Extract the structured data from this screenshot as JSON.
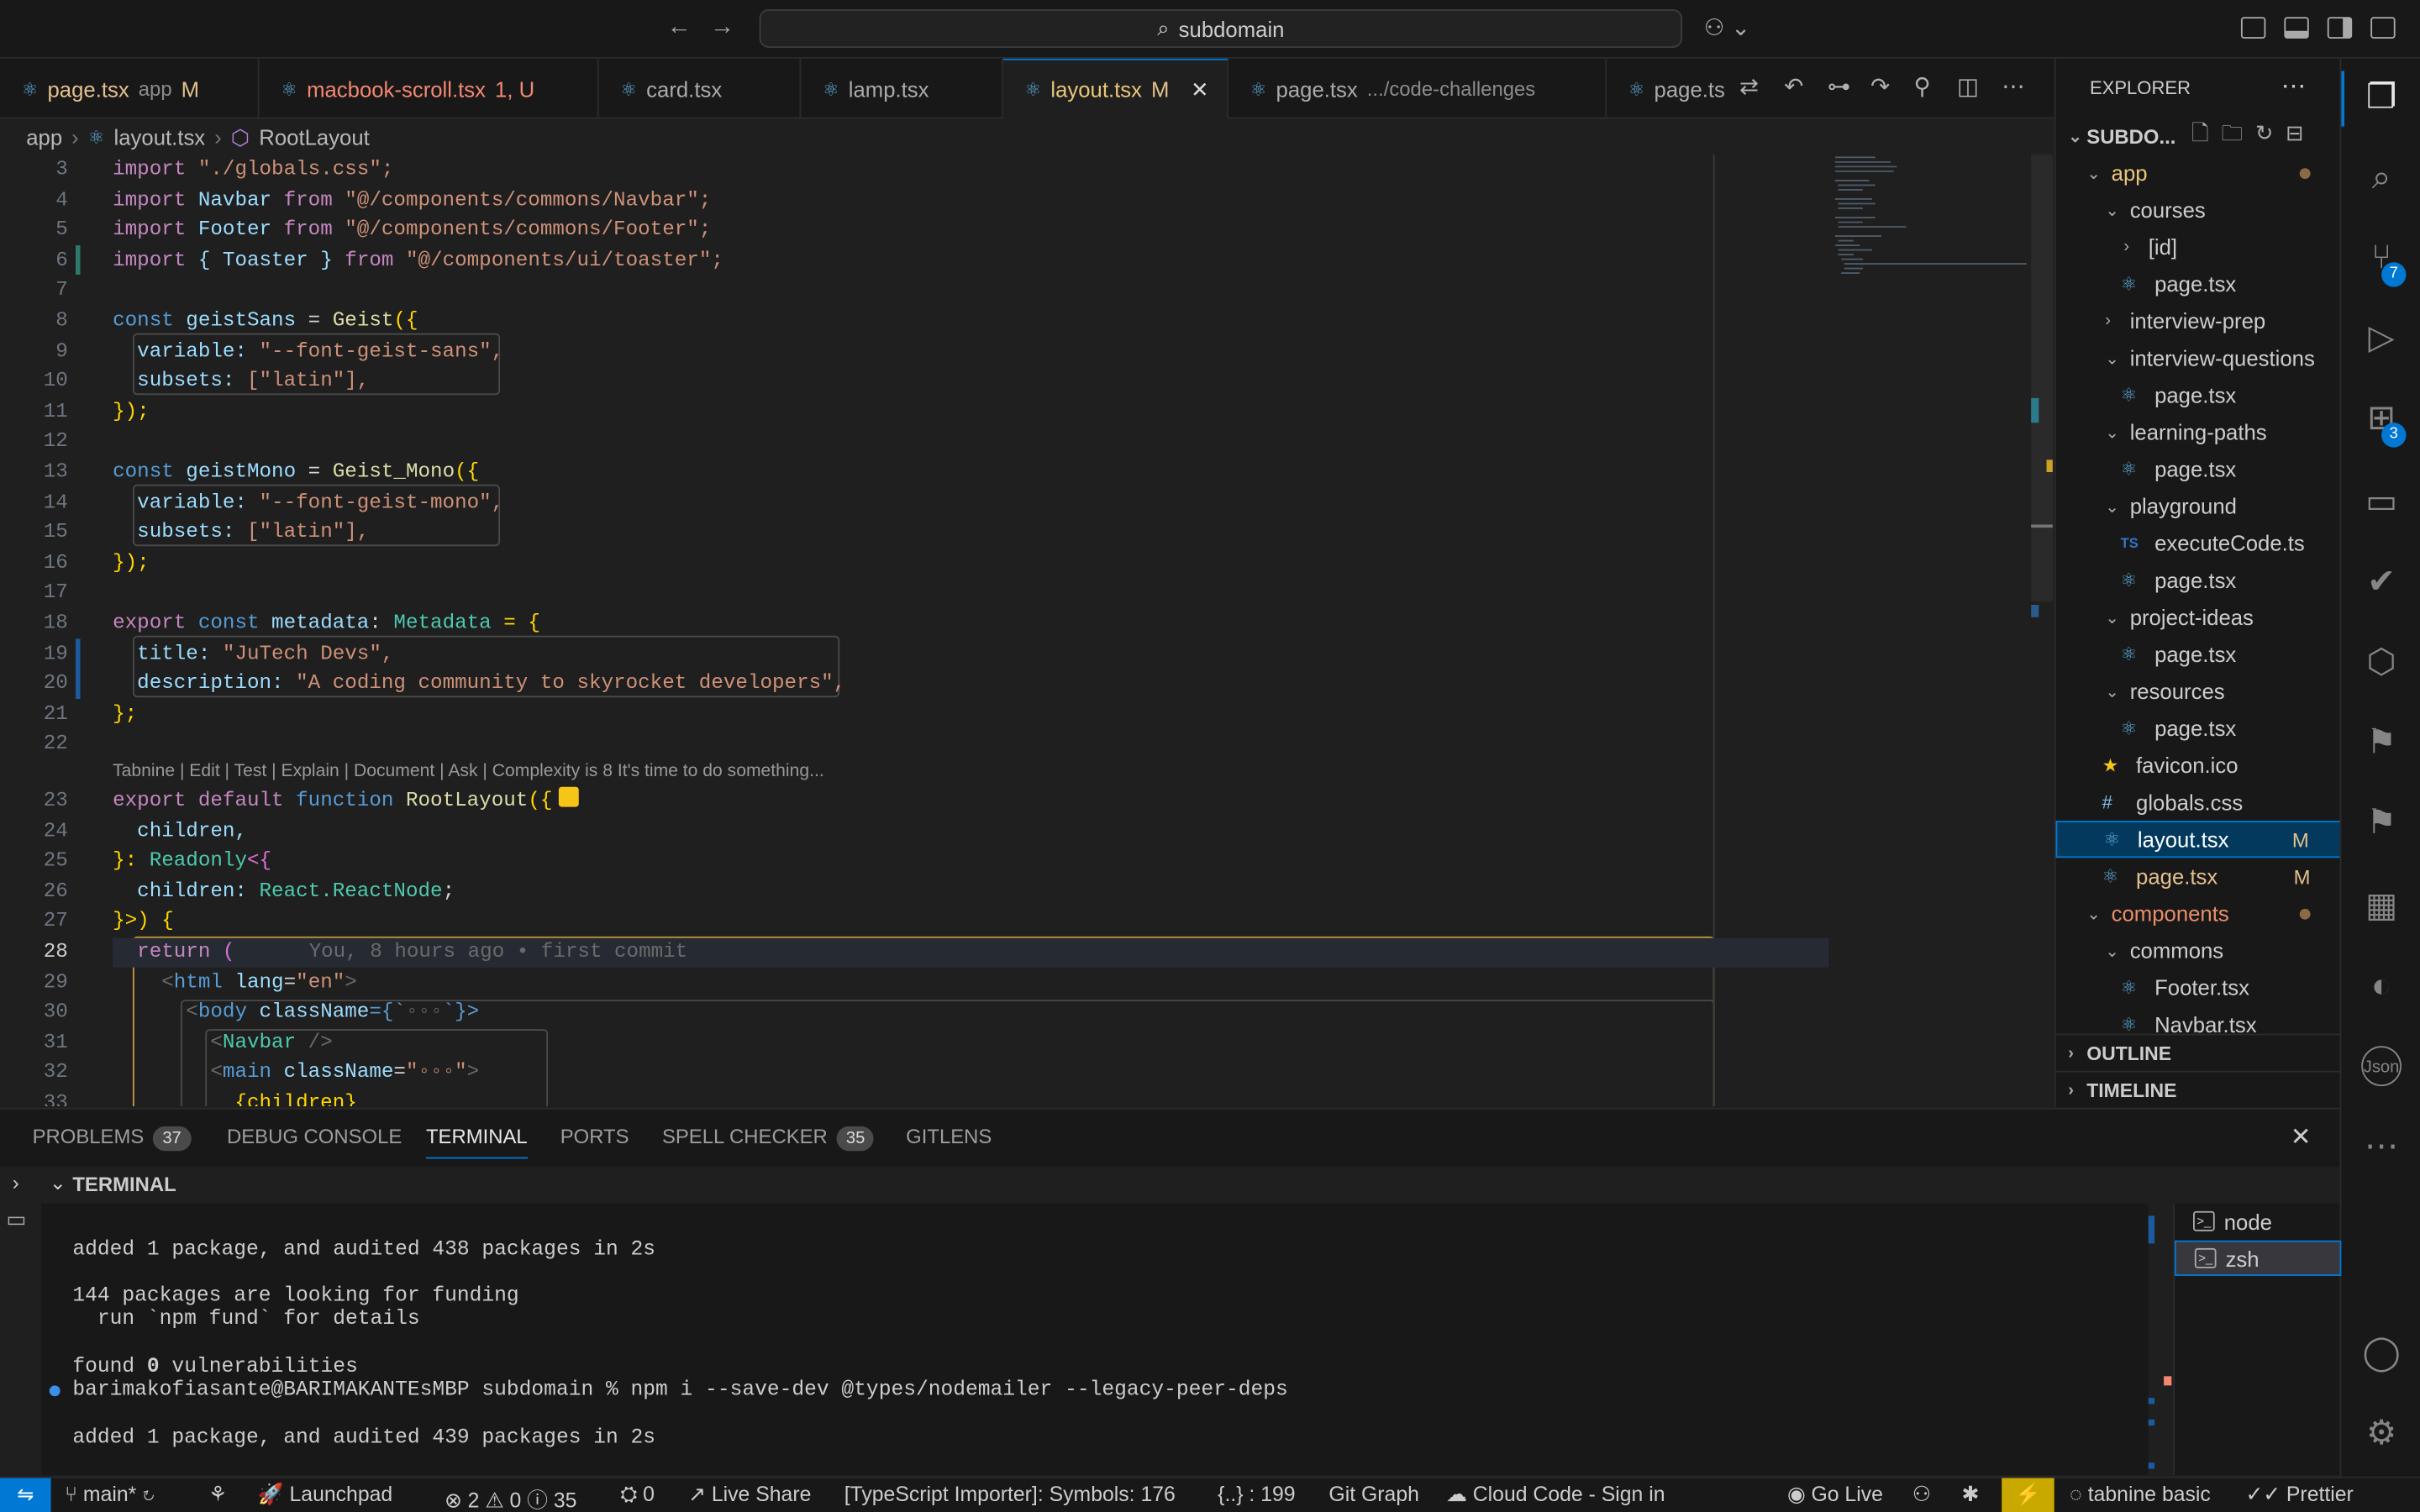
{
  "title_bar": {
    "search": "subdomain",
    "back_icon": "arrow-left-icon",
    "forward_icon": "arrow-right-icon"
  },
  "tabs": [
    {
      "label": "page.tsx",
      "suffix": "app",
      "status": "M"
    },
    {
      "label": "macbook-scroll.tsx",
      "suffix": "",
      "status": "1, U"
    },
    {
      "label": "card.tsx",
      "suffix": "",
      "status": ""
    },
    {
      "label": "lamp.tsx",
      "suffix": "",
      "status": ""
    },
    {
      "label": "layout.tsx",
      "suffix": "",
      "status": "M"
    },
    {
      "label": "page.tsx",
      "suffix": ".../code-challenges",
      "status": ""
    },
    {
      "label": "page.ts",
      "suffix": "",
      "status": ""
    }
  ],
  "breadcrumb": {
    "folder": "app",
    "file": "layout.tsx",
    "symbol": "RootLayout"
  },
  "editor": {
    "codelens": "Tabnine | Edit | Test | Explain | Document | Ask | Complexity is 8 It's time to do something...",
    "blame": "You, 8 hours ago • first commit",
    "line_numbers": [
      "3",
      "4",
      "5",
      "6",
      "7",
      "8",
      "9",
      "10",
      "11",
      "12",
      "13",
      "14",
      "15",
      "16",
      "17",
      "18",
      "19",
      "20",
      "21",
      "22",
      "23",
      "24",
      "25",
      "26",
      "27",
      "28",
      "29",
      "30",
      "31",
      "32",
      "33"
    ],
    "lines": {
      "l3": [
        "import",
        " \"./globals.css\";"
      ],
      "l4": [
        "import",
        " Navbar ",
        "from",
        " \"@/components/commons/Navbar\";"
      ],
      "l5": [
        "import",
        " Footer ",
        "from",
        " \"@/components/commons/Footer\";"
      ],
      "l6": [
        "import",
        " { Toaster } ",
        "from",
        " \"@/components/ui/toaster\";"
      ],
      "l8": [
        "const",
        " geistSans",
        " = ",
        "Geist",
        "({"
      ],
      "l9": [
        "  variable: ",
        "\"--font-geist-sans\","
      ],
      "l10": [
        "  subsets: ",
        "[\"latin\"],"
      ],
      "l11": [
        "});"
      ],
      "l13": [
        "const",
        " geistMono",
        " = ",
        "Geist_Mono",
        "({"
      ],
      "l14": [
        "  variable: ",
        "\"--font-geist-mono\","
      ],
      "l15": [
        "  subsets: ",
        "[\"latin\"],"
      ],
      "l16": [
        "});"
      ],
      "l18": [
        "export",
        " const",
        " metadata",
        ": ",
        "Metadata",
        " = {"
      ],
      "l19": [
        "  title: ",
        "\"JuTech Devs\","
      ],
      "l20": [
        "  description: ",
        "\"A coding community to skyrocket developers\","
      ],
      "l21": [
        "};"
      ],
      "l23": [
        "export",
        " default",
        " function",
        " RootLayout",
        "({"
      ],
      "l24": [
        "  children,"
      ],
      "l25": [
        "}: ",
        "Readonly",
        "<{"
      ],
      "l26": [
        "  children: ",
        "React.ReactNode",
        ";"
      ],
      "l27": [
        "}>) {"
      ],
      "l28": [
        "  return",
        " ("
      ],
      "l29": [
        "    <",
        "html",
        " lang",
        "=",
        "\"en\"",
        ">"
      ],
      "l30": [
        "      <",
        "body",
        " className",
        "={`",
        "◦◦◦",
        "`}>"
      ],
      "l31": [
        "        <",
        "Navbar",
        " />"
      ],
      "l32": [
        "        <",
        "main",
        " className",
        "=",
        "\"◦◦◦\"",
        ">"
      ],
      "l33": [
        "          {children}"
      ]
    }
  },
  "panel": {
    "tabs": [
      "PROBLEMS",
      "DEBUG CONSOLE",
      "TERMINAL",
      "PORTS",
      "SPELL CHECKER",
      "GITLENS"
    ],
    "problems_count": "37",
    "spell_count": "35",
    "terminal_title": "TERMINAL",
    "terminal_lines": [
      "added 1 package, and audited 438 packages in 2s",
      "144 packages are looking for funding",
      "  run `npm fund` for details",
      "found ",
      "0",
      " vulnerabilities",
      "barimakofiasante@BARIMAKANTEsMBP subdomain % npm i --save-dev @types/nodemailer --legacy-peer-deps",
      "added 1 package, and audited 439 packages in 2s"
    ],
    "shells": [
      "node",
      "zsh"
    ]
  },
  "explorer": {
    "title": "EXPLORER",
    "root": "SUBDO...",
    "items": [
      {
        "label": "app",
        "kind": "folder-open",
        "depth": 1,
        "color": "folder",
        "mark": "dot"
      },
      {
        "label": "courses",
        "kind": "folder-open",
        "depth": 2
      },
      {
        "label": "[id]",
        "kind": "folder",
        "depth": 3
      },
      {
        "label": "page.tsx",
        "kind": "react",
        "depth": 3
      },
      {
        "label": "interview-prep",
        "kind": "folder",
        "depth": 2
      },
      {
        "label": "interview-questions",
        "kind": "folder-open",
        "depth": 2
      },
      {
        "label": "page.tsx",
        "kind": "react",
        "depth": 3
      },
      {
        "label": "learning-paths",
        "kind": "folder-open",
        "depth": 2
      },
      {
        "label": "page.tsx",
        "kind": "react",
        "depth": 3
      },
      {
        "label": "playground",
        "kind": "folder-open",
        "depth": 2
      },
      {
        "label": "executeCode.ts",
        "kind": "ts",
        "depth": 3
      },
      {
        "label": "page.tsx",
        "kind": "react",
        "depth": 3
      },
      {
        "label": "project-ideas",
        "kind": "folder-open",
        "depth": 2
      },
      {
        "label": "page.tsx",
        "kind": "react",
        "depth": 3
      },
      {
        "label": "resources",
        "kind": "folder-open",
        "depth": 2
      },
      {
        "label": "page.tsx",
        "kind": "react",
        "depth": 3
      },
      {
        "label": "favicon.ico",
        "kind": "star",
        "depth": 2
      },
      {
        "label": "globals.css",
        "kind": "css",
        "depth": 2
      },
      {
        "label": "layout.tsx",
        "kind": "react",
        "depth": 2,
        "mark": "M",
        "selected": true
      },
      {
        "label": "page.tsx",
        "kind": "react",
        "depth": 2,
        "mark": "M",
        "color": "modified"
      },
      {
        "label": "components",
        "kind": "folder-open",
        "depth": 1,
        "color": "error",
        "mark": "dot"
      },
      {
        "label": "commons",
        "kind": "folder-open",
        "depth": 2
      },
      {
        "label": "Footer.tsx",
        "kind": "react",
        "depth": 3
      },
      {
        "label": "Navbar.tsx",
        "kind": "react",
        "depth": 3
      }
    ],
    "outline": "OUTLINE",
    "timeline": "TIMELINE"
  },
  "activity_badges": {
    "source_control": "7",
    "extensions": "3"
  },
  "status_bar": {
    "branch": "main*",
    "launchpad": "Launchpad",
    "errors": "2",
    "warnings": "0",
    "info": "35",
    "ports": "0",
    "live_share": "Live Share",
    "ts_importer": "[TypeScript Importer]: Symbols: 176",
    "json_count": "{..} : 199",
    "git_graph": "Git Graph",
    "cloud_code": "Cloud Code - Sign in",
    "go_live": "Go Live",
    "tabnine": "tabnine basic",
    "prettier": "Prettier"
  }
}
